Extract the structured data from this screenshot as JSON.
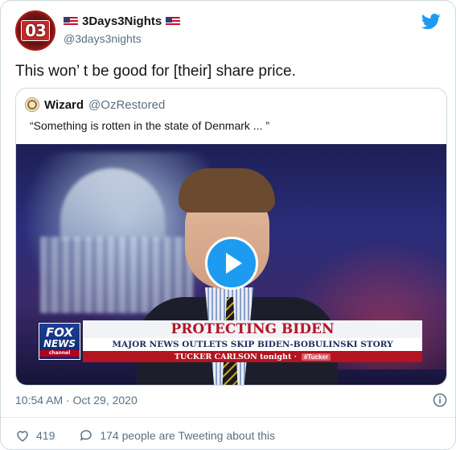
{
  "tweet": {
    "author": {
      "name": "3Days3Nights",
      "handle": "@3days3nights",
      "avatar_text": "03"
    },
    "text": "This won’ t be good for [their] share price.",
    "timestamp": "10:54 AM · Oct 29, 2020",
    "likes": "419",
    "replies_text": "174 people are Tweeting about this"
  },
  "quote": {
    "author": {
      "name": "Wizard",
      "handle": "@OzRestored"
    },
    "text": "“Something is rotten in the state of Denmark ... ”",
    "video": {
      "network_logo_top": "FOX",
      "network_logo_bottom": "NEWS",
      "network_logo_channel": "channel",
      "chyron_title": "PROTECTING BIDEN",
      "chyron_subtitle": "MAJOR NEWS OUTLETS SKIP BIDEN-BOBULINSKI STORY",
      "chyron_show": "TUCKER CARLSON tonight ·",
      "chyron_hashtag": "#Tucker"
    }
  },
  "colors": {
    "accent": "#1d9bf0",
    "secondary_text": "#5b7083",
    "chyron_red": "#b0162a"
  },
  "icons": [
    "twitter-bird-icon",
    "play-icon",
    "info-icon",
    "heart-icon",
    "reply-icon"
  ]
}
